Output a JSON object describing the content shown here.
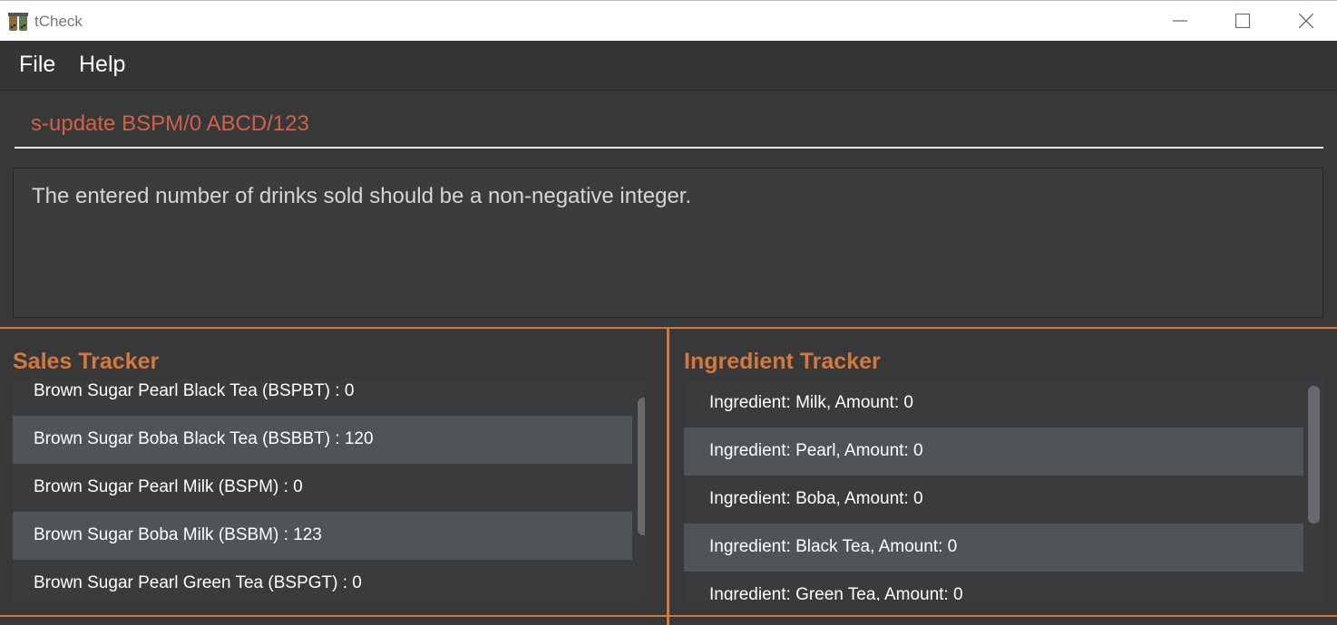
{
  "window": {
    "title": "tCheck"
  },
  "menu": {
    "items": [
      "File",
      "Help"
    ]
  },
  "command": {
    "value": "s-update BSPM/0 ABCD/123"
  },
  "result": {
    "message": "The entered number of drinks sold should be a non-negative integer."
  },
  "sales": {
    "title": "Sales Tracker",
    "items": [
      "Brown Sugar Pearl Black Tea (BSPBT) : 0",
      "Brown Sugar Boba Black Tea (BSBBT) : 120",
      "Brown Sugar Pearl Milk (BSPM) : 0",
      "Brown Sugar Boba Milk (BSBM) : 123",
      "Brown Sugar Pearl Green Tea (BSPGT) : 0"
    ]
  },
  "ingredients": {
    "title": "Ingredient Tracker",
    "items": [
      "Ingredient: Milk,  Amount: 0",
      "Ingredient: Pearl,  Amount: 0",
      "Ingredient: Boba,  Amount: 0",
      "Ingredient: Black Tea,  Amount: 0",
      "Ingredient: Green Tea,  Amount: 0"
    ]
  },
  "colors": {
    "accent": "#d3783f",
    "command_text": "#d0624a",
    "background": "#383838"
  }
}
